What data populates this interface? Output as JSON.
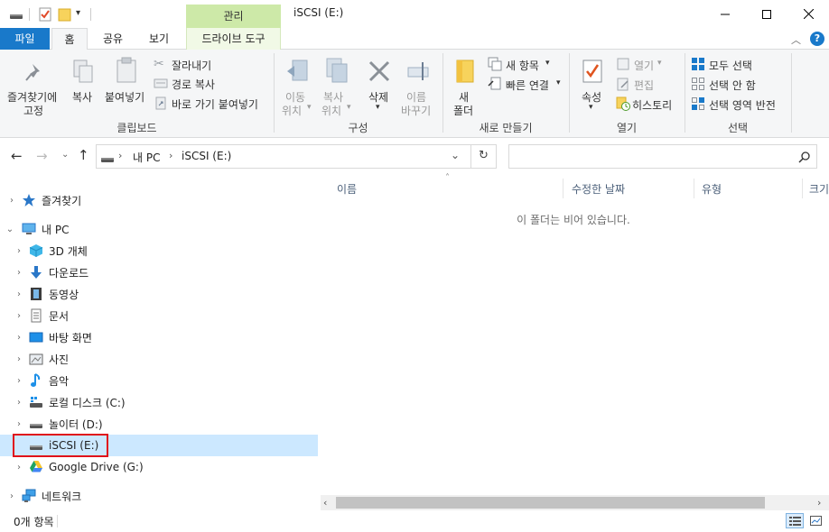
{
  "window": {
    "title": "iSCSI (E:)",
    "context_header": "관리"
  },
  "tabs": {
    "file": "파일",
    "home": "홈",
    "share": "공유",
    "view": "보기",
    "drive_tools": "드라이브 도구"
  },
  "ribbon": {
    "clipboard": {
      "pin_line1": "즐겨찾기에",
      "pin_line2": "고정",
      "copy": "복사",
      "paste": "붙여넣기",
      "cut": "잘라내기",
      "copy_path": "경로 복사",
      "paste_shortcut": "바로 가기 붙여넣기",
      "title": "클립보드"
    },
    "organize": {
      "move_line1": "이동",
      "move_line2": "위치",
      "copyto_line1": "복사",
      "copyto_line2": "위치",
      "delete": "삭제",
      "rename_line1": "이름",
      "rename_line2": "바꾸기",
      "title": "구성"
    },
    "new": {
      "folder_line1": "새",
      "folder_line2": "폴더",
      "new_item": "새 항목",
      "easy_access": "빠른 연결",
      "title": "새로 만들기"
    },
    "open": {
      "properties": "속성",
      "open": "열기",
      "edit": "편집",
      "history": "히스토리",
      "title": "열기"
    },
    "select": {
      "select_all": "모두 선택",
      "select_none": "선택 안 함",
      "invert": "선택 영역 반전",
      "title": "선택"
    }
  },
  "address": {
    "crumb_root": "내 PC",
    "crumb_current": "iSCSI (E:)",
    "search_placeholder": ""
  },
  "nav": {
    "quick_access": "즐겨찾기",
    "this_pc": "내 PC",
    "items": [
      {
        "label": "3D 개체",
        "icon": "3d-objects-icon"
      },
      {
        "label": "다운로드",
        "icon": "downloads-icon"
      },
      {
        "label": "동영상",
        "icon": "videos-icon"
      },
      {
        "label": "문서",
        "icon": "documents-icon"
      },
      {
        "label": "바탕 화면",
        "icon": "desktop-icon"
      },
      {
        "label": "사진",
        "icon": "pictures-icon"
      },
      {
        "label": "음악",
        "icon": "music-icon"
      },
      {
        "label": "로컬 디스크 (C:)",
        "icon": "local-disk-icon"
      },
      {
        "label": "놀이터 (D:)",
        "icon": "drive-icon"
      },
      {
        "label": "iSCSI (E:)",
        "icon": "drive-icon"
      },
      {
        "label": "Google Drive (G:)",
        "icon": "google-drive-icon"
      }
    ],
    "network": "네트워크"
  },
  "content": {
    "columns": [
      "이름",
      "수정한 날짜",
      "유형",
      "크기"
    ],
    "empty_message": "이 폴더는 비어 있습니다."
  },
  "status": {
    "item_count": "0개 항목"
  },
  "colors": {
    "file_tab": "#1979ca",
    "context_tab": "#cde9a8",
    "selection": "#cce8ff",
    "highlight_border": "#e0121a"
  }
}
